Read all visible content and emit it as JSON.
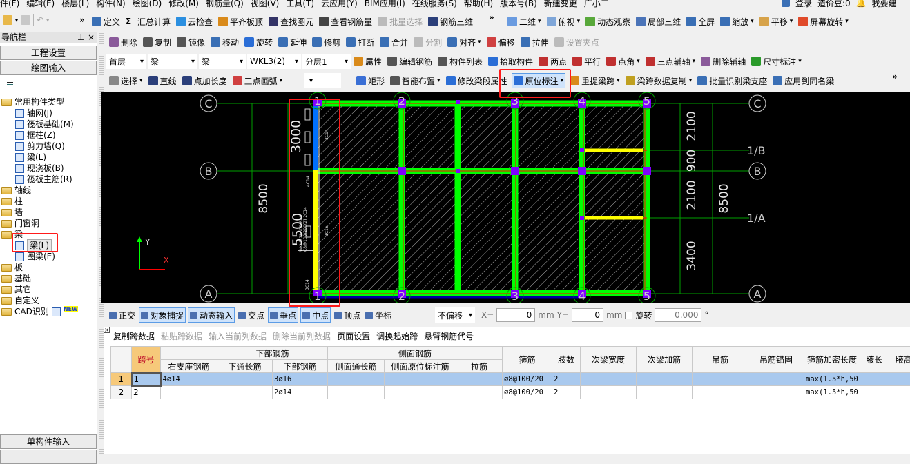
{
  "menu": [
    "件(F)",
    "编辑(E)",
    "楼层(L)",
    "构件(N)",
    "绘图(D)",
    "修改(M)",
    "钢筋量(Q)",
    "视图(V)",
    "工具(T)",
    "云应用(Y)",
    "BIM应用(I)",
    "在线服务(S)",
    "帮助(H)",
    "版本号(B)",
    "新建变更",
    "广小二"
  ],
  "menu_right": [
    "登录",
    "造价豆:0",
    "我要建"
  ],
  "toolbar1": [
    {
      "label": "定义",
      "icon": "define-icon",
      "color": "#3a6fb5"
    },
    {
      "label": "汇总计算",
      "icon": "sigma-icon",
      "color": "#000000"
    },
    {
      "label": "云检查",
      "icon": "cloud-check-icon",
      "color": "#2b8fe0"
    },
    {
      "label": "平齐板顶",
      "icon": "align-slab-icon",
      "color": "#d98a1a"
    },
    {
      "label": "查找图元",
      "icon": "binoculars-icon",
      "color": "#333366"
    },
    {
      "label": "查看钢筋量",
      "icon": "glasses-icon",
      "color": "#444444"
    },
    {
      "label": "批量选择",
      "icon": "batch-select-icon",
      "color": "#bbbbbb",
      "disabled": true
    },
    {
      "label": "钢筋三维",
      "icon": "rebar-3d-icon",
      "color": "#2b3f7a"
    }
  ],
  "toolbar1_view": [
    {
      "label": "二维",
      "icon": "2d-icon",
      "color": "#6a9be0",
      "dropdown": true
    },
    {
      "label": "俯视",
      "icon": "top-view-icon",
      "color": "#7fa6d8",
      "dropdown": true
    },
    {
      "label": "动态观察",
      "icon": "orbit-icon",
      "color": "#58a83a"
    },
    {
      "label": "局部三维",
      "icon": "local-3d-icon",
      "color": "#4b74b8"
    },
    {
      "label": "全屏",
      "icon": "fullscreen-icon",
      "color": "#3a6fb5"
    },
    {
      "label": "缩放",
      "icon": "zoom-icon",
      "color": "#3a6fb5",
      "dropdown": true
    },
    {
      "label": "平移",
      "icon": "pan-icon",
      "color": "#d7a34a",
      "dropdown": true
    },
    {
      "label": "屏幕旋转",
      "icon": "screen-rotate-icon",
      "color": "#e04a2a",
      "dropdown": true
    }
  ],
  "toolbar2": [
    {
      "label": "删除",
      "icon": "eraser-icon",
      "color": "#8a5a9a"
    },
    {
      "label": "复制",
      "icon": "copy-icon",
      "color": "#555555"
    },
    {
      "label": "镜像",
      "icon": "mirror-icon",
      "color": "#555555"
    },
    {
      "label": "移动",
      "icon": "move-icon",
      "color": "#3a6fb5"
    },
    {
      "label": "旋转",
      "icon": "rotate-icon",
      "color": "#2b6ed6"
    },
    {
      "label": "延伸",
      "icon": "extend-icon",
      "color": "#3a6fb5"
    },
    {
      "label": "修剪",
      "icon": "trim-icon",
      "color": "#3a6fb5"
    },
    {
      "label": "打断",
      "icon": "break-icon",
      "color": "#3a6fb5"
    },
    {
      "label": "合并",
      "icon": "merge-icon",
      "color": "#3a6fb5"
    },
    {
      "label": "分割",
      "icon": "split-icon",
      "color": "#bbbbbb",
      "disabled": true
    },
    {
      "label": "对齐",
      "icon": "align-icon",
      "color": "#3a6fb5",
      "dropdown": true
    },
    {
      "label": "偏移",
      "icon": "offset-icon",
      "color": "#d04040"
    },
    {
      "label": "拉伸",
      "icon": "stretch-icon",
      "color": "#3a6fb5"
    },
    {
      "label": "设置夹点",
      "icon": "grip-icon",
      "color": "#bbbbbb",
      "disabled": true
    }
  ],
  "selectors": {
    "floor": "首层",
    "category": "梁",
    "type": "梁",
    "component": "WKL3(2)",
    "layer": "分层1"
  },
  "toolbar3": [
    {
      "label": "属性",
      "icon": "properties-icon",
      "color": "#d98a1a"
    },
    {
      "label": "编辑钢筋",
      "icon": "edit-rebar-icon",
      "color": "#555555"
    },
    {
      "label": "构件列表",
      "icon": "component-list-icon",
      "color": "#555555"
    },
    {
      "label": "拾取构件",
      "icon": "pick-component-icon",
      "color": "#2b6ed6"
    },
    {
      "label": "两点",
      "icon": "two-point-axis-icon",
      "color": "#c03030"
    },
    {
      "label": "平行",
      "icon": "parallel-axis-icon",
      "color": "#c03030"
    },
    {
      "label": "点角",
      "icon": "point-angle-axis-icon",
      "color": "#c03030",
      "dropdown": true
    },
    {
      "label": "三点辅轴",
      "icon": "three-point-axis-icon",
      "color": "#c03030",
      "dropdown": true
    },
    {
      "label": "删除辅轴",
      "icon": "delete-axis-icon",
      "color": "#8a5a9a"
    },
    {
      "label": "尺寸标注",
      "icon": "dimension-icon",
      "color": "#2a9a2a",
      "dropdown": true
    }
  ],
  "toolbar4": [
    {
      "label": "选择",
      "icon": "cursor-icon",
      "color": "#888888",
      "dropdown": true
    },
    {
      "label": "直线",
      "icon": "line-icon",
      "color": "#2b3f7a"
    },
    {
      "label": "点加长度",
      "icon": "point-length-icon",
      "color": "#2b3f7a"
    },
    {
      "label": "三点画弧",
      "icon": "arc-icon",
      "color": "#d04040",
      "dropdown": true
    }
  ],
  "toolbar4b": [
    {
      "label": "矩形",
      "icon": "rectangle-icon",
      "color": "#3a6fd5"
    },
    {
      "label": "智能布置",
      "icon": "smart-layout-icon",
      "color": "#555555",
      "dropdown": true
    },
    {
      "label": "修改梁段属性",
      "icon": "modify-beam-segment-icon",
      "color": "#2b6ed6"
    },
    {
      "label": "原位标注",
      "icon": "in-situ-annotation-icon",
      "color": "#2b6ed6",
      "dropdown": true,
      "active": true
    },
    {
      "label": "重提梁跨",
      "icon": "re-extract-span-icon",
      "color": "#d98a1a",
      "dropdown": true
    },
    {
      "label": "梁跨数据复制",
      "icon": "span-data-copy-icon",
      "color": "#c0a020",
      "dropdown": true
    },
    {
      "label": "批量识别梁支座",
      "icon": "batch-identify-support-icon",
      "color": "#3a6fb5"
    },
    {
      "label": "应用到同名梁",
      "icon": "apply-same-name-icon",
      "color": "#3a6fb5"
    }
  ],
  "nav": {
    "title": "导航栏",
    "project_settings": "工程设置",
    "drawing_input": "绘图输入",
    "single_input": "单构件输入",
    "tree": [
      {
        "label": "常用构件类型",
        "level": 0,
        "open": true
      },
      {
        "label": "轴网(J)",
        "level": 1,
        "icon": "axis-grid-icon"
      },
      {
        "label": "筏板基础(M)",
        "level": 1,
        "icon": "raft-foundation-icon"
      },
      {
        "label": "框柱(Z)",
        "level": 1,
        "icon": "frame-column-icon"
      },
      {
        "label": "剪力墙(Q)",
        "level": 1,
        "icon": "shear-wall-icon"
      },
      {
        "label": "梁(L)",
        "level": 1,
        "icon": "beam-icon"
      },
      {
        "label": "现浇板(B)",
        "level": 1,
        "icon": "slab-icon"
      },
      {
        "label": "筏板主筋(R)",
        "level": 1,
        "icon": "raft-rebar-icon"
      },
      {
        "label": "轴线",
        "level": 0
      },
      {
        "label": "柱",
        "level": 0
      },
      {
        "label": "墙",
        "level": 0
      },
      {
        "label": "门窗洞",
        "level": 0
      },
      {
        "label": "梁",
        "level": 0,
        "open": true
      },
      {
        "label": "梁(L)",
        "level": 1,
        "icon": "beam-icon",
        "selected": true
      },
      {
        "label": "圈梁(E)",
        "level": 1,
        "icon": "ring-beam-icon"
      },
      {
        "label": "板",
        "level": 0
      },
      {
        "label": "基础",
        "level": 0
      },
      {
        "label": "其它",
        "level": 0
      },
      {
        "label": "自定义",
        "level": 0
      },
      {
        "label": "CAD识别",
        "level": 0,
        "badge": "NEW"
      }
    ]
  },
  "canvas": {
    "axes_x": [
      "1",
      "2",
      "3",
      "4",
      "5"
    ],
    "axes_y": [
      "C",
      "B",
      "A",
      "1/B",
      "1/A"
    ],
    "dims_left": "8500",
    "dims_right": [
      "2100",
      "900",
      "2100",
      "3400"
    ],
    "dims_right_total": "8500",
    "beam_dims": [
      "3000",
      "5500"
    ],
    "beam_labels": [
      "3C14",
      "4C14",
      "3C16",
      "3C14"
    ],
    "beam_note": [
      "WKL3(2) 300*600",
      "C8@100/200(2) 2C14"
    ],
    "ucs": {
      "y": "Y",
      "x": "X"
    },
    "colors": {
      "beam": "#00ff00",
      "selected_span1": "#ffff00",
      "selected_span2": "#0070ff",
      "column": "#8000ff",
      "axis": "#00aa00",
      "secondary_beam": "#ffff00"
    }
  },
  "snapbar": {
    "items": [
      {
        "label": "正交",
        "icon": "orthogonal-icon",
        "active": false
      },
      {
        "label": "对象捕捉",
        "icon": "object-snap-icon",
        "active": true
      },
      {
        "label": "动态输入",
        "icon": "dynamic-input-icon",
        "active": true
      },
      {
        "label": "交点",
        "icon": "intersection-icon",
        "active": false
      },
      {
        "label": "垂点",
        "icon": "perpendicular-icon",
        "active": true
      },
      {
        "label": "中点",
        "icon": "midpoint-icon",
        "active": true
      },
      {
        "label": "顶点",
        "icon": "vertex-icon",
        "active": false
      },
      {
        "label": "坐标",
        "icon": "coordinate-icon",
        "active": false
      }
    ],
    "offset": "不偏移",
    "x_label": "X=",
    "x": "0",
    "y_label": "Y=",
    "y": "0",
    "unit": "mm",
    "rotate_label": "旋转",
    "rotate": "0.000",
    "degree": "°"
  },
  "table_toolbar": [
    {
      "label": "复制跨数据",
      "enabled": true
    },
    {
      "label": "粘贴跨数据",
      "enabled": false
    },
    {
      "label": "输入当前列数据",
      "enabled": false
    },
    {
      "label": "删除当前列数据",
      "enabled": false
    },
    {
      "label": "页面设置",
      "enabled": true
    },
    {
      "label": "调换起始跨",
      "enabled": true
    },
    {
      "label": "悬臂钢筋代号",
      "enabled": true
    }
  ],
  "table": {
    "group_headers": {
      "bottom": "下部钢筋",
      "side": "侧面钢筋"
    },
    "columns": [
      "跨号",
      "右支座钢筋",
      "下通长筋",
      "下部钢筋",
      "侧面通长筋",
      "侧面原位标注筋",
      "拉筋",
      "箍筋",
      "肢数",
      "次梁宽度",
      "次梁加筋",
      "吊筋",
      "吊筋锚固",
      "箍筋加密长度",
      "腋长",
      "腋高"
    ],
    "rows": [
      [
        "1",
        "1",
        "4⌀14",
        "",
        "3⌀16",
        "",
        "",
        "",
        "⌀8@100/20",
        "2",
        "",
        "",
        "",
        "",
        "max(1.5*h,50",
        "",
        ""
      ],
      [
        "2",
        "2",
        "",
        "",
        "2⌀14",
        "",
        "",
        "",
        "⌀8@100/20",
        "2",
        "",
        "",
        "",
        "",
        "max(1.5*h,50",
        "",
        ""
      ]
    ]
  }
}
